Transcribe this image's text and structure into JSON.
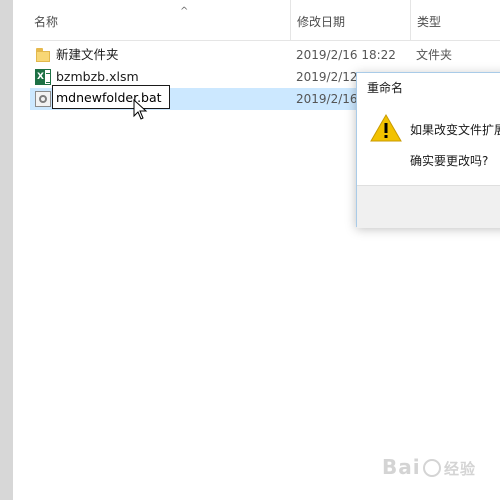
{
  "columns": {
    "name": "名称",
    "date": "修改日期",
    "type": "类型"
  },
  "files": [
    {
      "name": "新建文件夹",
      "date": "2019/2/16 18:22",
      "type": "文件夹",
      "icon": "folder-icon"
    },
    {
      "name": "bzmbzb.xlsm",
      "date": "2019/2/12",
      "type": "",
      "icon": "excel-icon"
    },
    {
      "name": "",
      "date": "2019/2/16",
      "type": "",
      "icon": "bat-file-icon"
    }
  ],
  "rename": {
    "value": "mdnewfolder.bat"
  },
  "dialog": {
    "title": "重命名",
    "message_line1": "如果改变文件扩展",
    "message_line2": "确实要更改吗?"
  },
  "colors": {
    "selected_row": "#cce8ff",
    "dialog_border": "#a9cbe8",
    "warning": "#f2c200"
  }
}
